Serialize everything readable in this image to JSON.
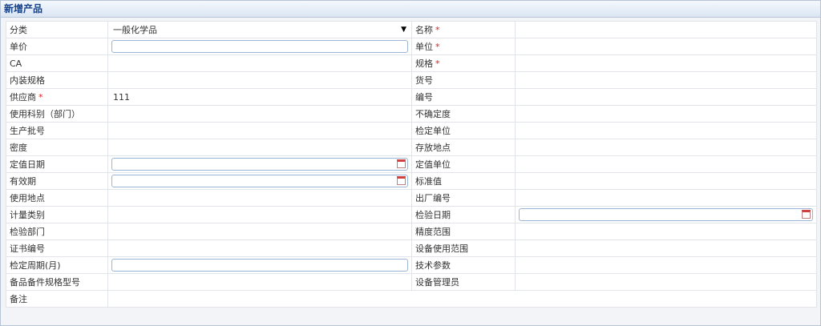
{
  "panel": {
    "title": "新增产品"
  },
  "form": {
    "category_label": "分类",
    "category_value": "一般化学品",
    "name_label": "名称",
    "unit_price_label": "单价",
    "unit_label": "单位",
    "ca_label": "CA",
    "spec_label": "规格",
    "package_spec_label": "内装规格",
    "model_label": "货号",
    "supplier_label": "供应商",
    "supplier_value": "111",
    "number_label": "编号",
    "usage_dept_label": "使用科别（部门）",
    "uncertainty_label": "不确定度",
    "batch_label": "生产批号",
    "verify_unit_label": "检定单位",
    "density_label": "密度",
    "storage_label": "存放地点",
    "valuation_date_label": "定值日期",
    "valuation_unit_label": "定值单位",
    "valid_period_label": "有效期",
    "standard_value_label": "标准值",
    "use_location_label": "使用地点",
    "factory_number_label": "出厂编号",
    "measure_type_label": "计量类别",
    "verify_date_label": "检验日期",
    "verify_dept_label": "检验部门",
    "accuracy_label": "精度范围",
    "certificate_label": "证书编号",
    "device_range_label": "设备使用范围",
    "verify_cycle_label": "检定周期(月)",
    "tech_params_label": "技术参数",
    "spare_model_label": "备品备件规格型号",
    "device_admin_label": "设备管理员",
    "remark_label": "备注",
    "required_mark": "*"
  }
}
